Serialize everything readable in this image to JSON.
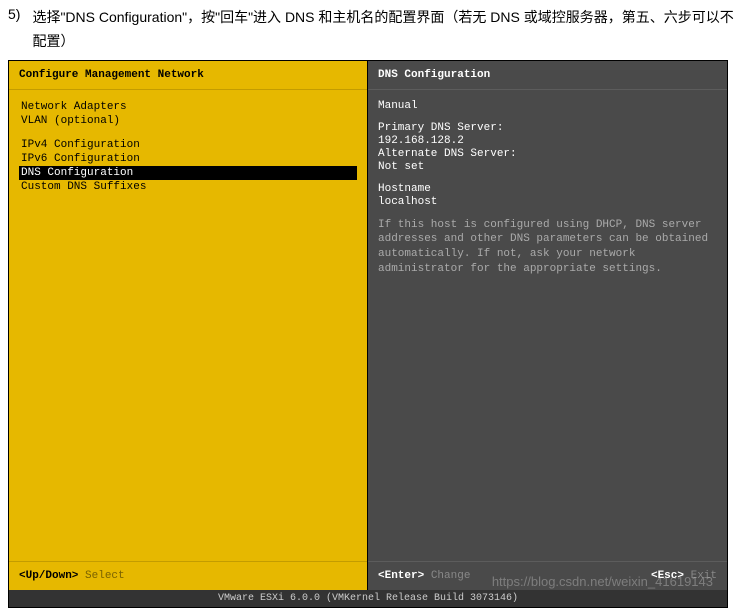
{
  "doc": {
    "num": "5)",
    "text": "选择\"DNS Configuration\"，按\"回车\"进入 DNS 和主机名的配置界面（若无 DNS 或域控服务器，第五、六步可以不配置）"
  },
  "left": {
    "title": "Configure Management Network",
    "groups": [
      {
        "items": [
          "Network Adapters",
          "VLAN (optional)"
        ]
      },
      {
        "items": [
          "IPv4 Configuration",
          "IPv6 Configuration",
          "DNS Configuration",
          "Custom DNS Suffixes"
        ]
      }
    ],
    "selected": "DNS Configuration",
    "footer_key": "<Up/Down>",
    "footer_label": "Select"
  },
  "right": {
    "title": "DNS Configuration",
    "mode": "Manual",
    "primary_label": "Primary DNS Server:",
    "primary_value": "192.168.128.2",
    "alternate_label": "Alternate DNS Server:",
    "alternate_value": "Not set",
    "hostname_label": "Hostname",
    "hostname_value": "localhost",
    "help": "If this host is configured using DHCP, DNS server addresses and other DNS parameters can be obtained automatically. If not, ask your network administrator for the appropriate settings.",
    "footer_enter_key": "<Enter>",
    "footer_enter_label": "Change",
    "footer_esc_key": "<Esc>",
    "footer_esc_label": "Exit"
  },
  "status": "VMware ESXi 6.0.0 (VMKernel Release Build 3073146)",
  "watermark": "https://blog.csdn.net/weixin_41619143"
}
